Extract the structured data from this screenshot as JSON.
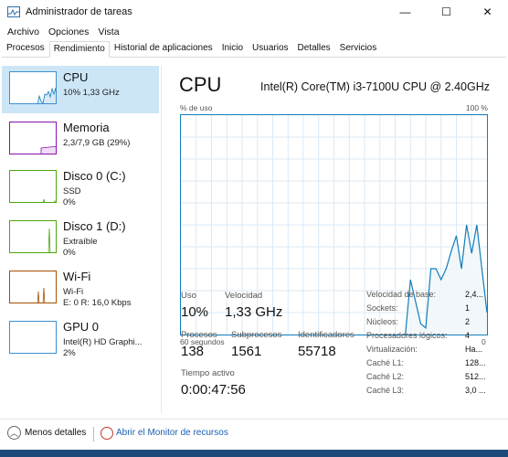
{
  "window": {
    "title": "Administrador de tareas",
    "controls": {
      "minimize": "—",
      "maximize": "☐",
      "close": "✕"
    }
  },
  "menu": [
    "Archivo",
    "Opciones",
    "Vista"
  ],
  "tabs": [
    "Procesos",
    "Rendimiento",
    "Historial de aplicaciones",
    "Inicio",
    "Usuarios",
    "Detalles",
    "Servicios"
  ],
  "active_tab": "Rendimiento",
  "sidebar": [
    {
      "name": "CPU",
      "sub1": "10% 1,33 GHz",
      "sub2": "",
      "color": "#117dbb",
      "selected": true
    },
    {
      "name": "Memoria",
      "sub1": "2,3/7,9 GB (29%)",
      "sub2": "",
      "color": "#8b12ae",
      "selected": false
    },
    {
      "name": "Disco 0 (C:)",
      "sub1": "SSD",
      "sub2": "0%",
      "color": "#4da60c",
      "selected": false
    },
    {
      "name": "Disco 1 (D:)",
      "sub1": "Extraíble",
      "sub2": "0%",
      "color": "#4da60c",
      "selected": false
    },
    {
      "name": "Wi-Fi",
      "sub1": "Wi-Fi",
      "sub2": "E: 0 R: 16,0 Kbps",
      "color": "#a74f01",
      "selected": false
    },
    {
      "name": "GPU 0",
      "sub1": "Intel(R) HD Graphi...",
      "sub2": "2%",
      "color": "#117dbb",
      "selected": false
    }
  ],
  "main": {
    "title": "CPU",
    "model": "Intel(R) Core(TM) i3-7100U CPU @ 2.40GHz",
    "axis_left": "% de uso",
    "axis_right": "100 %",
    "axis_time": "60 segundos",
    "axis_zero": "0",
    "usage_label": "Uso",
    "usage_value": "10%",
    "speed_label": "Velocidad",
    "speed_value": "1,33 GHz",
    "processes_label": "Procesos",
    "processes_value": "138",
    "threads_label": "Subprocesos",
    "threads_value": "1561",
    "handles_label": "Identificadores",
    "handles_value": "55718",
    "uptime_label": "Tiempo activo",
    "uptime_value": "0:00:47:56"
  },
  "info": [
    {
      "key": "Velocidad de base:",
      "value": "2,4..."
    },
    {
      "key": "Sockets:",
      "value": "1"
    },
    {
      "key": "Núcleos:",
      "value": "2"
    },
    {
      "key": "Procesadores lógicos:",
      "value": "4"
    },
    {
      "key": "Virtualización:",
      "value": "Ha..."
    },
    {
      "key": "Caché L1:",
      "value": "128..."
    },
    {
      "key": "Caché L2:",
      "value": "512..."
    },
    {
      "key": "Caché L3:",
      "value": "3,0 ..."
    }
  ],
  "footer": {
    "fewer_details": "Menos detalles",
    "open_monitor": "Abrir el Monitor de recursos"
  },
  "chart_data": {
    "type": "area",
    "ylim": [
      0,
      100
    ],
    "xlim": [
      60,
      0
    ],
    "series": [
      {
        "x": [
          16,
          15,
          14,
          13,
          12,
          11,
          10,
          9,
          8,
          7,
          6,
          5,
          4,
          3,
          2,
          1,
          0
        ],
        "values": [
          0,
          25,
          15,
          5,
          3,
          30,
          30,
          25,
          30,
          38,
          45,
          30,
          50,
          37,
          50,
          30,
          10
        ]
      }
    ]
  }
}
